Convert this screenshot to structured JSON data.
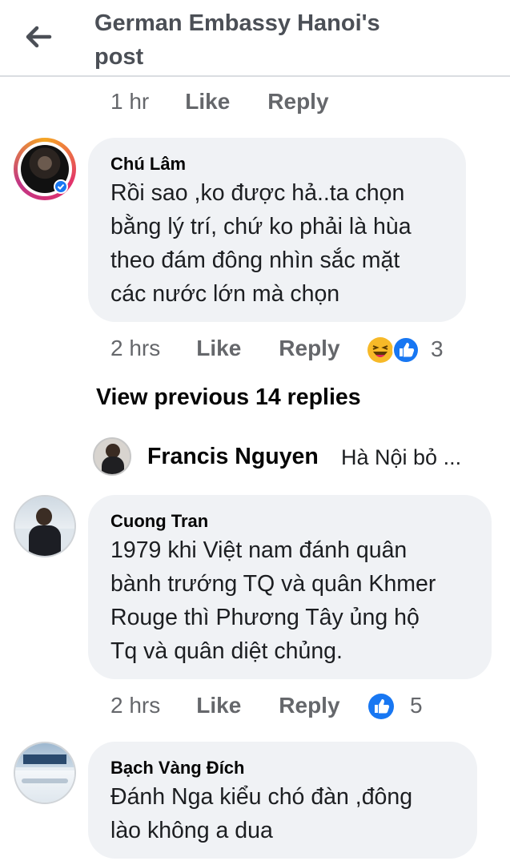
{
  "header": {
    "title": "German Embassy Hanoi's post"
  },
  "top_meta": {
    "time": "1 hr",
    "like": "Like",
    "reply": "Reply"
  },
  "comments": [
    {
      "author": "Chú Lâm",
      "lines": [
        "Rồi sao ,ko được hả..ta chọn",
        "bằng lý trí, chứ ko phải là hùa",
        "theo đám đông nhìn sắc mặt",
        "các nước lớn mà chọn"
      ],
      "time": "2 hrs",
      "like": "Like",
      "reply": "Reply",
      "reaction_count": "3"
    },
    {
      "author": "Cuong Tran",
      "lines": [
        "1979 khi Việt nam đánh quân",
        "bành trướng TQ và quân Khmer",
        "Rouge thì Phương Tây ủng hộ",
        "Tq và quân diệt chủng."
      ],
      "time": "2 hrs",
      "like": "Like",
      "reply": "Reply",
      "reaction_count": "5"
    },
    {
      "author": "Bạch Vàng Đích",
      "lines": [
        "Đánh Nga kiểu  chó đàn ,đông",
        "lào không a dua"
      ]
    }
  ],
  "view_previous": "View previous 14 replies",
  "reply_preview": {
    "author": "Francis Nguyen",
    "snippet": "Hà Nội bỏ ..."
  },
  "colors": {
    "bubble": "#f0f2f5",
    "meta_text": "#65676b",
    "like_blue": "#1877f2",
    "haha_yellow": "#f7b928"
  }
}
